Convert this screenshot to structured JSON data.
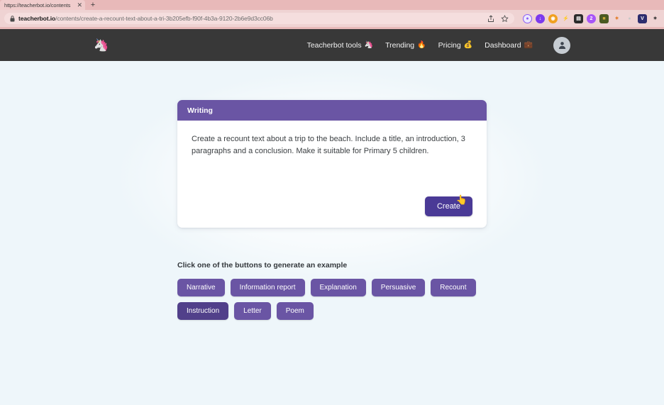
{
  "browser": {
    "tab": {
      "title": "https://teacherbot.io/contents",
      "close_icon": "close-icon"
    },
    "new_tab_label": "+",
    "url_domain": "teacherbot.io",
    "url_path": "/contents/create-a-recount-text-about-a-tri-3b205efb-f90f-4b3a-9120-2b6e9d3cc06b",
    "lock_icon": "lock-icon",
    "share_icon": "share-icon",
    "bookmark_icon": "star-icon",
    "extensions": [
      {
        "name": "extension-icon-1",
        "glyph": "○",
        "color": "#8b5cf6",
        "bg": "#ede9fe",
        "shape": "circle"
      },
      {
        "name": "extension-icon-2",
        "glyph": "↓",
        "color": "#ffffff",
        "bg": "#7c3aed",
        "shape": "circle"
      },
      {
        "name": "extension-icon-3",
        "glyph": "◉",
        "color": "#ffffff",
        "bg": "#f0a020",
        "shape": "circle"
      },
      {
        "name": "extension-icon-4",
        "glyph": "⚡",
        "color": "#d4634a",
        "bg": "transparent",
        "shape": "circle"
      },
      {
        "name": "extension-icon-5",
        "glyph": "▤",
        "color": "#ffffff",
        "bg": "#2b2b2b",
        "shape": "square"
      },
      {
        "name": "extension-icon-6",
        "glyph": "2",
        "color": "#ffffff",
        "bg": "#a855f7",
        "shape": "circle"
      },
      {
        "name": "extension-icon-7",
        "glyph": "■",
        "color": "#caa83a",
        "bg": "#4a5a22",
        "shape": "square"
      },
      {
        "name": "extension-icon-8",
        "glyph": "✦",
        "color": "#e2761b",
        "bg": "transparent",
        "shape": "circle"
      },
      {
        "name": "extension-icon-9",
        "glyph": "●",
        "color": "#c8c8c8",
        "bg": "transparent",
        "shape": "circle"
      },
      {
        "name": "extension-icon-10",
        "glyph": "V",
        "color": "#ffffff",
        "bg": "#2d2d6e",
        "shape": "square"
      },
      {
        "name": "extension-icon-11",
        "glyph": "✶",
        "color": "#2b2b2b",
        "bg": "transparent",
        "shape": "circle"
      }
    ]
  },
  "site": {
    "logo_emoji": "🦄",
    "nav": [
      {
        "label": "Teacherbot tools",
        "emoji": "🦄"
      },
      {
        "label": "Trending",
        "emoji": "🔥"
      },
      {
        "label": "Pricing",
        "emoji": "💰"
      },
      {
        "label": "Dashboard",
        "emoji": "💼"
      }
    ],
    "avatar_icon": "user-avatar-icon"
  },
  "card": {
    "title": "Writing",
    "prompt": "Create a recount text about a trip to the beach. Include a title, an introduction, 3 paragraphs and a conclusion. Make it suitable for Primary 5 children.",
    "create_label": "Create",
    "cursor_glyph": "👆"
  },
  "examples": {
    "label": "Click one of the buttons to generate an example",
    "row1": [
      "Narrative",
      "Information report",
      "Explanation",
      "Persuasive",
      "Recount"
    ],
    "row2": [
      "Instruction",
      "Letter",
      "Poem"
    ]
  },
  "colors": {
    "brand_purple": "#6a55a4",
    "button_purple": "#4a3a96",
    "header_dark": "#383838",
    "page_bg": "#eef6fa"
  }
}
